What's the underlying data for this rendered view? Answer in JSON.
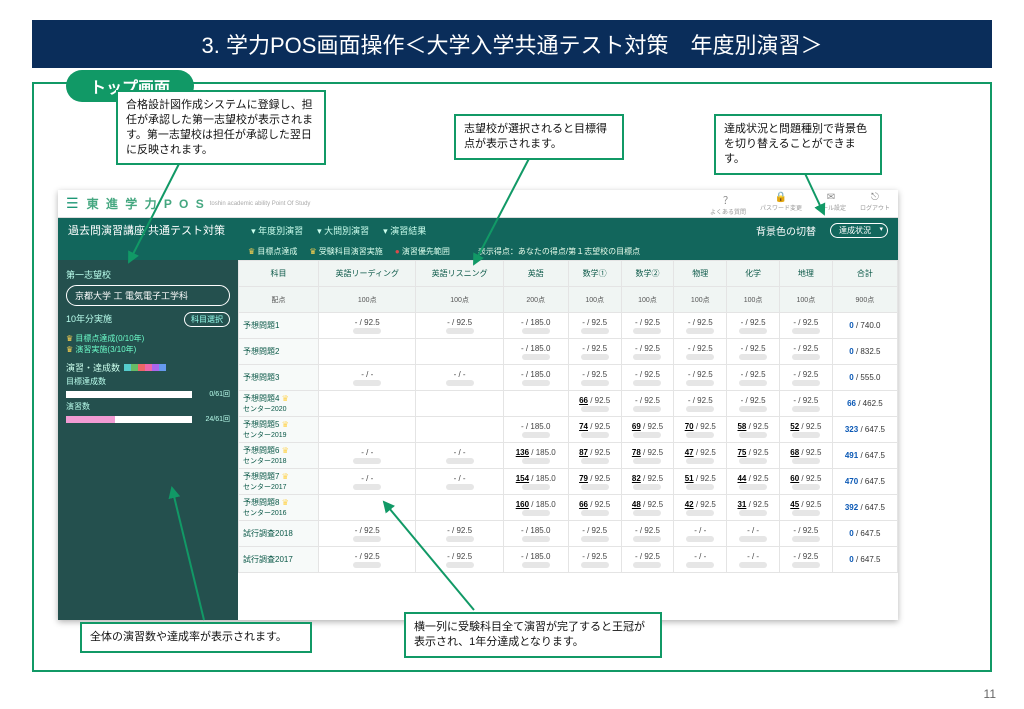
{
  "slide": {
    "title": "3. 学力POS画面操作＜大学入学共通テスト対策　年度別演習＞",
    "frame_label": "トップ画面",
    "page_number": "11"
  },
  "callouts": {
    "c1": "合格設計図作成システムに登録し、担任が承認した第一志望校が表示されます。第一志望校は担任が承認した翌日に反映されます。",
    "c2": "志望校が選択されると目標得点が表示されます。",
    "c3": "達成状況と問題種別で背景色を切り替えることができます。",
    "c4": "全体の演習数や達成率が表示されます。",
    "c5": "横一列に受験科目全て演習が完了すると王冠が表示され、1年分達成となります。"
  },
  "app": {
    "brand": "東 進 学 力  P O S",
    "brand_sub": "toshin academic ability Point Of Study",
    "header_icons": [
      {
        "glyph": "？",
        "label": "よくある質問"
      },
      {
        "glyph": "🔒",
        "label": "パスワード変更"
      },
      {
        "glyph": "✉",
        "label": "メール設定"
      },
      {
        "glyph": "⎋",
        "label": "ログアウト"
      }
    ],
    "nav": {
      "title": "過去問演習講座 共通テスト対策",
      "items": [
        "年度別演習",
        "大問別演習",
        "演習結果"
      ],
      "toggle_label": "背景色の切替",
      "toggle_value": "達成状況"
    },
    "legend": {
      "items": [
        "目標点達成",
        "受験科目演習実施",
        "演習優先範囲"
      ],
      "note": "表示得点：あなたの得点/第１志望校の目標点"
    },
    "sidebar": {
      "heading1": "第一志望校",
      "school": "京都大学 工 電気電子工学科",
      "subject_select": "科目選択",
      "plan": "10年分実施",
      "line1": "目標点達成(0/10年)",
      "line2": "演習実施(3/10年)",
      "heading2": "演習・達成数",
      "row1_label": "目標達成数",
      "row1_count": "0/61回",
      "row2_label": "演習数",
      "row2_count": "24/61回"
    },
    "table": {
      "subject_header": "科目",
      "max_header": "配点",
      "columns": [
        {
          "name": "英語リーディング",
          "max": "100点"
        },
        {
          "name": "英語リスニング",
          "max": "100点"
        },
        {
          "name": "英語",
          "max": "200点"
        },
        {
          "name": "数学①",
          "max": "100点"
        },
        {
          "name": "数学②",
          "max": "100点"
        },
        {
          "name": "物理",
          "max": "100点"
        },
        {
          "name": "化学",
          "max": "100点"
        },
        {
          "name": "地理",
          "max": "100点"
        },
        {
          "name": "合計",
          "max": "900点"
        }
      ],
      "rows": [
        {
          "label": "予想問題1",
          "sub": "",
          "cells": [
            {
              "s": "-",
              "t": "92.5"
            },
            {
              "s": "-",
              "t": "92.5"
            },
            {
              "s": "-",
              "t": "185.0"
            },
            {
              "s": "-",
              "t": "92.5"
            },
            {
              "s": "-",
              "t": "92.5"
            },
            {
              "s": "-",
              "t": "92.5"
            },
            {
              "s": "-",
              "t": "92.5"
            },
            {
              "s": "-",
              "t": "92.5"
            }
          ],
          "total": {
            "v": "0",
            "t": "740.0"
          }
        },
        {
          "label": "予想問題2",
          "sub": "",
          "cells": [
            {
              "s": "",
              "t": ""
            },
            {
              "s": "",
              "t": ""
            },
            {
              "s": "-",
              "t": "185.0"
            },
            {
              "s": "-",
              "t": "92.5"
            },
            {
              "s": "-",
              "t": "92.5"
            },
            {
              "s": "-",
              "t": "92.5"
            },
            {
              "s": "-",
              "t": "92.5"
            },
            {
              "s": "-",
              "t": "92.5"
            }
          ],
          "total": {
            "v": "0",
            "t": "832.5"
          }
        },
        {
          "label": "予想問題3",
          "sub": "",
          "cells": [
            {
              "s": "-",
              "t": "-"
            },
            {
              "s": "-",
              "t": "-"
            },
            {
              "s": "-",
              "t": "185.0"
            },
            {
              "s": "-",
              "t": "92.5"
            },
            {
              "s": "-",
              "t": "92.5"
            },
            {
              "s": "-",
              "t": "92.5"
            },
            {
              "s": "-",
              "t": "92.5"
            },
            {
              "s": "-",
              "t": "92.5"
            }
          ],
          "total": {
            "v": "0",
            "t": "555.0"
          }
        },
        {
          "label": "予想問題4",
          "sub": "センター2020",
          "cells": [
            {
              "s": "",
              "t": ""
            },
            {
              "s": "",
              "t": ""
            },
            {
              "s": "",
              "t": ""
            },
            {
              "s": "66",
              "t": "92.5"
            },
            {
              "s": "-",
              "t": "92.5"
            },
            {
              "s": "-",
              "t": "92.5"
            },
            {
              "s": "-",
              "t": "92.5"
            },
            {
              "s": "-",
              "t": "92.5"
            }
          ],
          "total": {
            "v": "66",
            "t": "462.5"
          }
        },
        {
          "label": "予想問題5",
          "sub": "センター2019",
          "cells": [
            {
              "s": "",
              "t": ""
            },
            {
              "s": "",
              "t": ""
            },
            {
              "s": "-",
              "t": "185.0"
            },
            {
              "s": "74",
              "t": "92.5"
            },
            {
              "s": "69",
              "t": "92.5"
            },
            {
              "s": "70",
              "t": "92.5"
            },
            {
              "s": "58",
              "t": "92.5"
            },
            {
              "s": "52",
              "t": "92.5"
            }
          ],
          "total": {
            "v": "323",
            "t": "647.5"
          }
        },
        {
          "label": "予想問題6",
          "sub": "センター2018",
          "cells": [
            {
              "s": "-",
              "t": "-"
            },
            {
              "s": "-",
              "t": "-"
            },
            {
              "s": "136",
              "t": "185.0"
            },
            {
              "s": "87",
              "t": "92.5"
            },
            {
              "s": "78",
              "t": "92.5"
            },
            {
              "s": "47",
              "t": "92.5"
            },
            {
              "s": "75",
              "t": "92.5"
            },
            {
              "s": "68",
              "t": "92.5"
            }
          ],
          "total": {
            "v": "491",
            "t": "647.5"
          }
        },
        {
          "label": "予想問題7",
          "sub": "センター2017",
          "cells": [
            {
              "s": "-",
              "t": "-"
            },
            {
              "s": "-",
              "t": "-"
            },
            {
              "s": "154",
              "t": "185.0"
            },
            {
              "s": "79",
              "t": "92.5"
            },
            {
              "s": "82",
              "t": "92.5"
            },
            {
              "s": "51",
              "t": "92.5"
            },
            {
              "s": "44",
              "t": "92.5"
            },
            {
              "s": "60",
              "t": "92.5"
            }
          ],
          "total": {
            "v": "470",
            "t": "647.5"
          }
        },
        {
          "label": "予想問題8",
          "sub": "センター2016",
          "cells": [
            {
              "s": "",
              "t": ""
            },
            {
              "s": "",
              "t": ""
            },
            {
              "s": "160",
              "t": "185.0"
            },
            {
              "s": "66",
              "t": "92.5"
            },
            {
              "s": "48",
              "t": "92.5"
            },
            {
              "s": "42",
              "t": "92.5"
            },
            {
              "s": "31",
              "t": "92.5"
            },
            {
              "s": "45",
              "t": "92.5"
            }
          ],
          "total": {
            "v": "392",
            "t": "647.5"
          }
        },
        {
          "label": "試行調査2018",
          "sub": "",
          "cells": [
            {
              "s": "-",
              "t": "92.5"
            },
            {
              "s": "-",
              "t": "92.5"
            },
            {
              "s": "-",
              "t": "185.0"
            },
            {
              "s": "-",
              "t": "92.5"
            },
            {
              "s": "-",
              "t": "92.5"
            },
            {
              "s": "-",
              "t": "-"
            },
            {
              "s": "-",
              "t": "-"
            },
            {
              "s": "-",
              "t": "92.5"
            }
          ],
          "total": {
            "v": "0",
            "t": "647.5"
          }
        },
        {
          "label": "試行調査2017",
          "sub": "",
          "cells": [
            {
              "s": "-",
              "t": "92.5"
            },
            {
              "s": "-",
              "t": "92.5"
            },
            {
              "s": "-",
              "t": "185.0"
            },
            {
              "s": "-",
              "t": "92.5"
            },
            {
              "s": "-",
              "t": "92.5"
            },
            {
              "s": "-",
              "t": "-"
            },
            {
              "s": "-",
              "t": "-"
            },
            {
              "s": "-",
              "t": "92.5"
            }
          ],
          "total": {
            "v": "0",
            "t": "647.5"
          }
        }
      ]
    }
  }
}
